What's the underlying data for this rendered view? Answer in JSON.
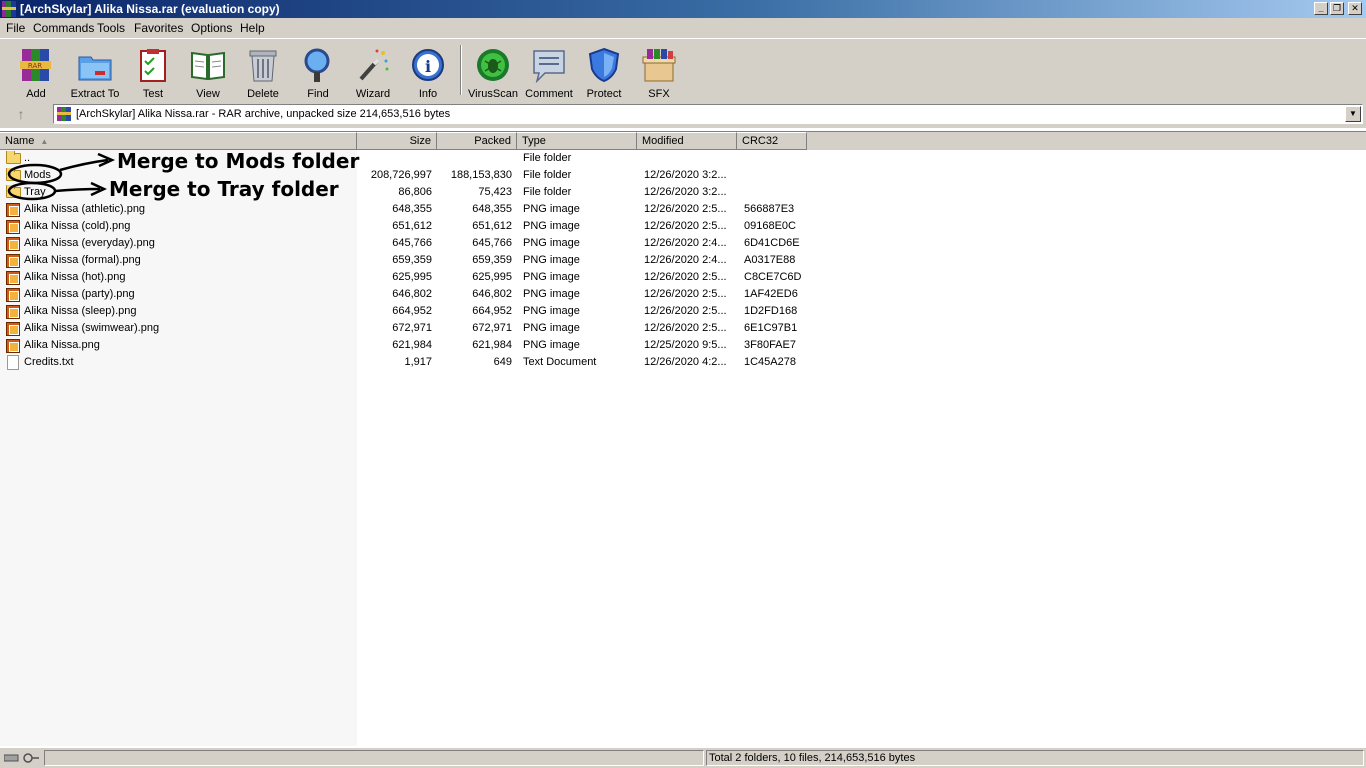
{
  "window": {
    "title": "[ArchSkylar] Alika Nissa.rar (evaluation copy)",
    "controls": [
      "_",
      "❐",
      "✕"
    ]
  },
  "menu": [
    "File",
    "Commands",
    "Tools",
    "Favorites",
    "Options",
    "Help"
  ],
  "toolbar": [
    {
      "label": "Add",
      "icon": "add-icon"
    },
    {
      "label": "Extract To",
      "icon": "extract-icon"
    },
    {
      "label": "Test",
      "icon": "test-icon"
    },
    {
      "label": "View",
      "icon": "view-icon"
    },
    {
      "label": "Delete",
      "icon": "delete-icon"
    },
    {
      "label": "Find",
      "icon": "find-icon"
    },
    {
      "label": "Wizard",
      "icon": "wizard-icon"
    },
    {
      "label": "Info",
      "icon": "info-icon"
    },
    {
      "label": "VirusScan",
      "icon": "virusscan-icon"
    },
    {
      "label": "Comment",
      "icon": "comment-icon"
    },
    {
      "label": "Protect",
      "icon": "protect-icon"
    },
    {
      "label": "SFX",
      "icon": "sfx-icon"
    }
  ],
  "address": {
    "up_symbol": "↑",
    "text": "[ArchSkylar] Alika Nissa.rar - RAR archive, unpacked size 214,653,516 bytes"
  },
  "columns": {
    "name": "Name",
    "size": "Size",
    "packed": "Packed",
    "type": "Type",
    "modified": "Modified",
    "crc": "CRC32"
  },
  "files": [
    {
      "name": "..",
      "size": "",
      "packed": "",
      "type": "File folder",
      "modified": "",
      "crc": "",
      "icon": "folder"
    },
    {
      "name": "Mods",
      "size": "208,726,997",
      "packed": "188,153,830",
      "type": "File folder",
      "modified": "12/26/2020 3:2...",
      "crc": "",
      "icon": "folder"
    },
    {
      "name": "Tray",
      "size": "86,806",
      "packed": "75,423",
      "type": "File folder",
      "modified": "12/26/2020 3:2...",
      "crc": "",
      "icon": "folder"
    },
    {
      "name": "Alika Nissa (athletic).png",
      "size": "648,355",
      "packed": "648,355",
      "type": "PNG image",
      "modified": "12/26/2020 2:5...",
      "crc": "566887E3",
      "icon": "png"
    },
    {
      "name": "Alika Nissa (cold).png",
      "size": "651,612",
      "packed": "651,612",
      "type": "PNG image",
      "modified": "12/26/2020 2:5...",
      "crc": "09168E0C",
      "icon": "png"
    },
    {
      "name": "Alika Nissa (everyday).png",
      "size": "645,766",
      "packed": "645,766",
      "type": "PNG image",
      "modified": "12/26/2020 2:4...",
      "crc": "6D41CD6E",
      "icon": "png"
    },
    {
      "name": "Alika Nissa (formal).png",
      "size": "659,359",
      "packed": "659,359",
      "type": "PNG image",
      "modified": "12/26/2020 2:4...",
      "crc": "A0317E88",
      "icon": "png"
    },
    {
      "name": "Alika Nissa (hot).png",
      "size": "625,995",
      "packed": "625,995",
      "type": "PNG image",
      "modified": "12/26/2020 2:5...",
      "crc": "C8CE7C6D",
      "icon": "png"
    },
    {
      "name": "Alika Nissa (party).png",
      "size": "646,802",
      "packed": "646,802",
      "type": "PNG image",
      "modified": "12/26/2020 2:5...",
      "crc": "1AF42ED6",
      "icon": "png"
    },
    {
      "name": "Alika Nissa (sleep).png",
      "size": "664,952",
      "packed": "664,952",
      "type": "PNG image",
      "modified": "12/26/2020 2:5...",
      "crc": "1D2FD168",
      "icon": "png"
    },
    {
      "name": "Alika Nissa (swimwear).png",
      "size": "672,971",
      "packed": "672,971",
      "type": "PNG image",
      "modified": "12/26/2020 2:5...",
      "crc": "6E1C97B1",
      "icon": "png"
    },
    {
      "name": "Alika Nissa.png",
      "size": "621,984",
      "packed": "621,984",
      "type": "PNG image",
      "modified": "12/25/2020 9:5...",
      "crc": "3F80FAE7",
      "icon": "png"
    },
    {
      "name": "Credits.txt",
      "size": "1,917",
      "packed": "649",
      "type": "Text Document",
      "modified": "12/26/2020 4:2...",
      "crc": "1C45A278",
      "icon": "txt"
    }
  ],
  "annotations": {
    "mods": "Merge to Mods folder",
    "tray": "Merge to Tray folder"
  },
  "status": {
    "left": "",
    "right": "Total 2 folders, 10 files, 214,653,516 bytes"
  }
}
